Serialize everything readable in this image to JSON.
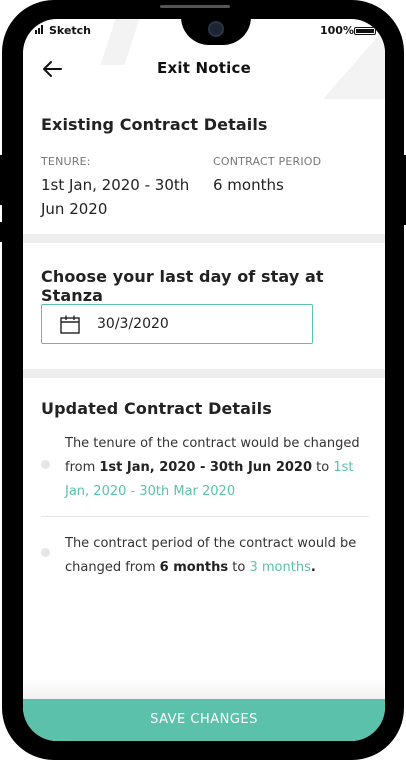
{
  "status_bar": {
    "carrier": "Sketch",
    "battery": "100%"
  },
  "header": {
    "title": "Exit Notice"
  },
  "existing": {
    "title": "Existing Contract Details",
    "tenure_label": "TENURE:",
    "tenure_value_line1": "1st Jan, 2020 - 30th",
    "tenure_value_line2": "Jun 2020",
    "period_label": "CONTRACT PERIOD",
    "period_value": "6 months"
  },
  "choose": {
    "title": "Choose your last day of stay at Stanza",
    "date_value": "30/3/2020"
  },
  "updated": {
    "title": "Updated Contract Details",
    "tenure_item": {
      "prefix": "The tenure of the contract would be changed from ",
      "old": "1st Jan, 2020 - 30th Jun 2020",
      "mid": " to ",
      "new": "1st Jan, 2020 - 30th Mar 2020"
    },
    "period_item": {
      "prefix": "The contract period of the contract would be changed from ",
      "old": "6 months",
      "mid": " to ",
      "new": "3 months",
      "suffix": "."
    }
  },
  "footer": {
    "save_label": "SAVE CHANGES"
  },
  "colors": {
    "accent": "#5cc1aa",
    "separator": "#eeeeee"
  },
  "icons": {
    "back": "arrow-left-icon",
    "calendar": "calendar-icon"
  }
}
